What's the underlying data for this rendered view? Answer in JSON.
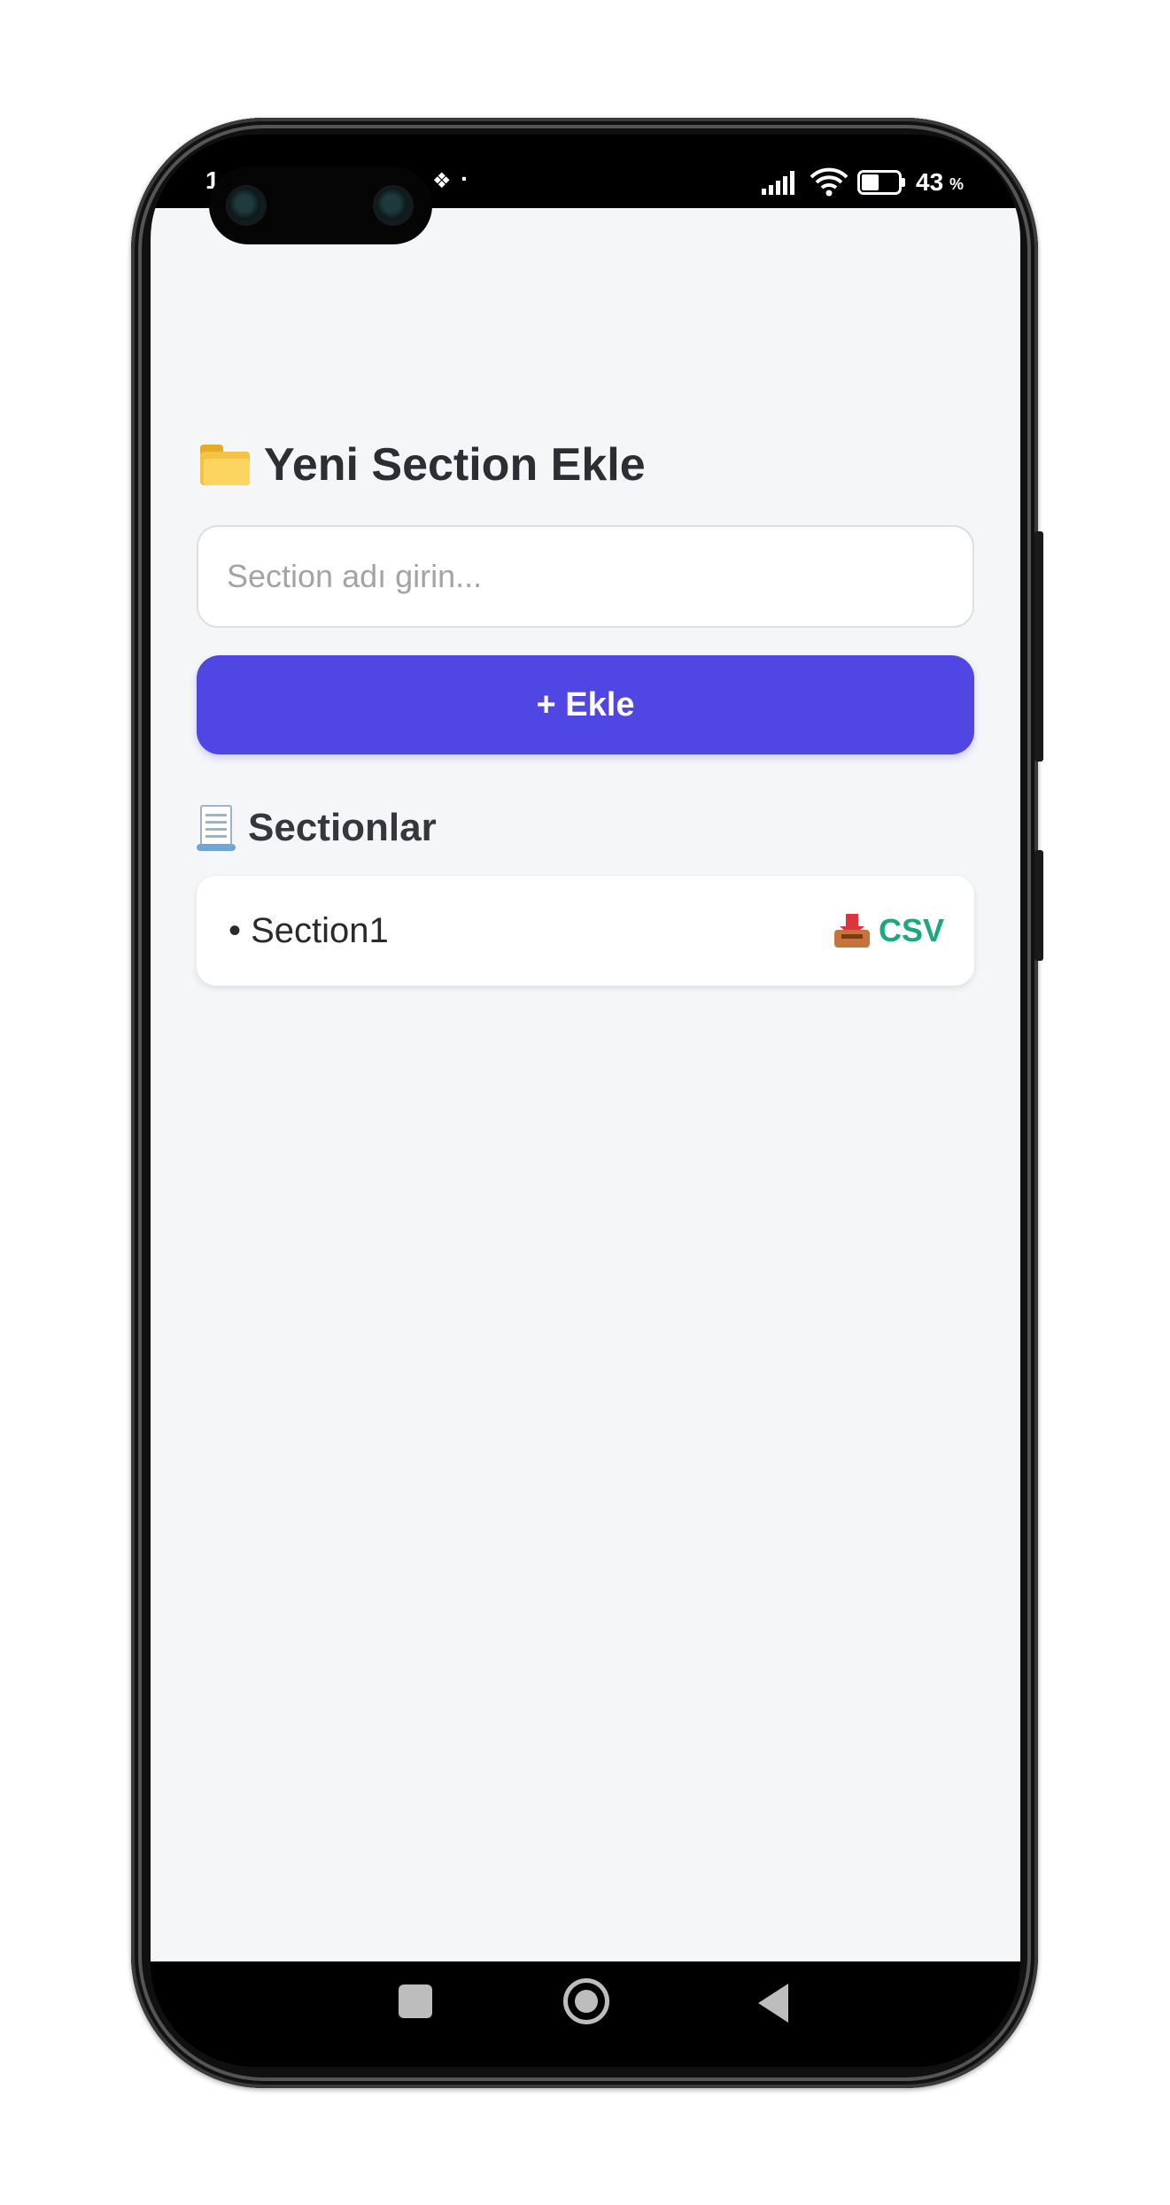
{
  "status_bar": {
    "time_partial": "1",
    "battery_percent": "43",
    "percent_sign": "%",
    "dot": "·"
  },
  "new_section": {
    "title": "Yeni Section Ekle",
    "input_placeholder": "Section adı girin...",
    "input_value": "",
    "add_button_label": "+ Ekle"
  },
  "sections": {
    "title": "Sectionlar",
    "items": [
      {
        "label": "• Section1",
        "action_label": "CSV"
      }
    ]
  },
  "icons": {
    "title_icon": "folder-icon",
    "list_icon": "document-icon",
    "csv_icon": "inbox-tray-icon"
  },
  "colors": {
    "accent": "#5046e4",
    "csv_text": "#1aa97a",
    "background": "#f5f6f8"
  }
}
